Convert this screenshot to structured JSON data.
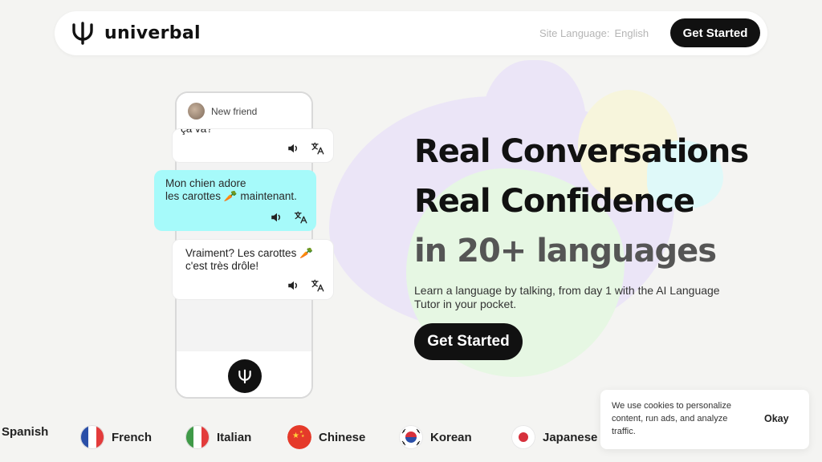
{
  "header": {
    "brand": "univerbal",
    "site_language_label": "Site Language:",
    "site_language_value": "English",
    "cta_label": "Get Started"
  },
  "chat": {
    "friend_name": "New friend",
    "messages": [
      {
        "text": "ça va?"
      },
      {
        "text": "Mon chien adore\nles carottes 🥕 maintenant."
      },
      {
        "text": "Vraiment? Les carottes 🥕\nc'est très drôle!"
      }
    ]
  },
  "hero": {
    "line1": "Real Conversations",
    "line2": "Real Confidence",
    "line3": "in 20+ languages",
    "subtitle": "Learn a language by talking, from day 1 with the AI Language Tutor in your pocket.",
    "cta_label": "Get Started"
  },
  "languages": [
    {
      "name": "Spanish"
    },
    {
      "name": "French",
      "icon": "flag-france-icon"
    },
    {
      "name": "Italian",
      "icon": "flag-italy-icon"
    },
    {
      "name": "Chinese",
      "icon": "flag-china-icon"
    },
    {
      "name": "Korean",
      "icon": "flag-korea-icon"
    },
    {
      "name": "Japanese",
      "icon": "flag-japan-icon"
    }
  ],
  "cookie": {
    "text": "We use cookies to personalize content, run ads, and analyze traffic.",
    "ok_label": "Okay"
  },
  "colors": {
    "accent_dark": "#111111",
    "bubble_highlight": "#a6fafa",
    "blob_purple": "#ebe5f7",
    "blob_green": "#e6f7e3",
    "blob_yellow": "#f7f5dc"
  }
}
